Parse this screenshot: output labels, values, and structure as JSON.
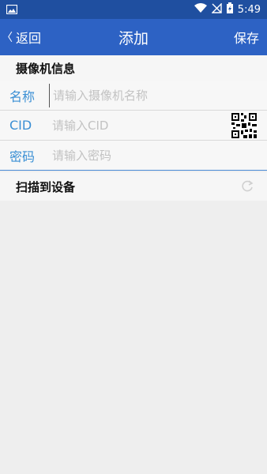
{
  "status_bar": {
    "time": "5:49",
    "icons": [
      "image-icon",
      "wifi-icon",
      "no-signal-icon",
      "battery-charging-icon"
    ]
  },
  "nav": {
    "back_label": "返回",
    "title": "添加",
    "save_label": "保存"
  },
  "camera_info": {
    "section_title": "摄像机信息",
    "name_label": "名称",
    "name_placeholder": "请输入摄像机名称",
    "cid_label": "CID",
    "cid_placeholder": "请输入CID",
    "password_label": "密码",
    "password_placeholder": "请输入密码"
  },
  "scan": {
    "label": "扫描到设备"
  },
  "colors": {
    "nav_bar": "#2d62c4",
    "status_bar": "#1f4fa0",
    "label_blue": "#3a8fd4"
  }
}
